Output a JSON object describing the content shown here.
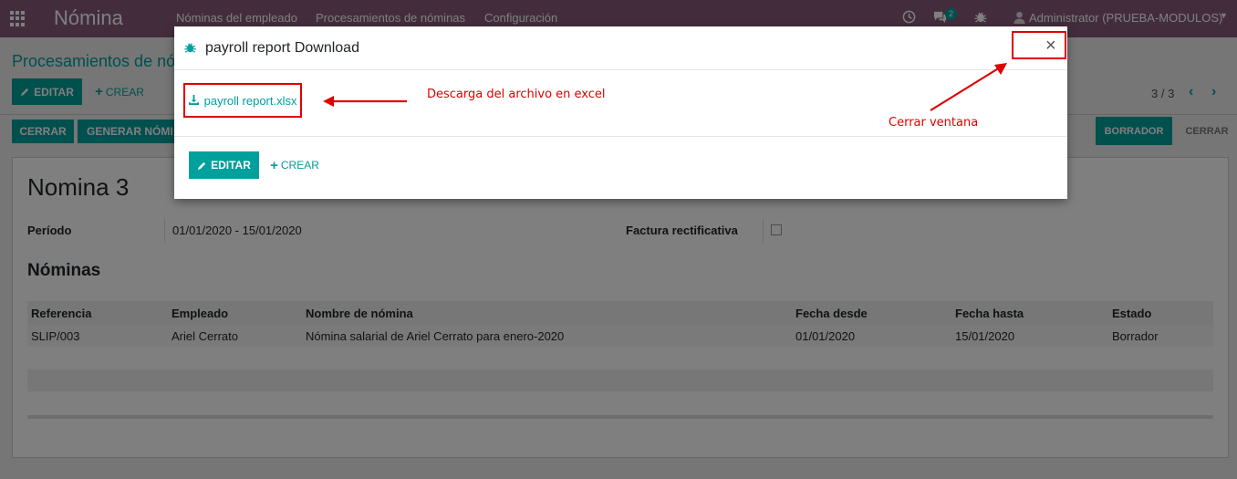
{
  "navbar": {
    "app_title": "Nómina",
    "menu": [
      "Nóminas del empleado",
      "Procesamientos de nóminas",
      "Configuración"
    ],
    "chat_badge": "2",
    "user": "Administrator (PRUEBA-MODULOS)"
  },
  "control": {
    "breadcrumb": "Procesamientos de nó",
    "edit": "EDITAR",
    "create": "CREAR",
    "pager": "3 / 3"
  },
  "statusbar": {
    "close_btn": "CERRAR",
    "generate_btn": "GENERAR NÓMI",
    "stages": [
      "BORRADOR",
      "CERRAR"
    ]
  },
  "form": {
    "title": "Nomina 3",
    "period_label": "Período",
    "period_value": "01/01/2020 - 15/01/2020",
    "refund_label": "Factura rectificativa",
    "section": "Nóminas",
    "columns": [
      "Referencia",
      "Empleado",
      "Nombre de nómina",
      "Fecha desde",
      "Fecha hasta",
      "Estado"
    ],
    "rows": [
      [
        "SLIP/003",
        "Ariel Cerrato",
        "Nómina salarial de Ariel Cerrato para enero-2020",
        "01/01/2020",
        "15/01/2020",
        "Borrador"
      ]
    ]
  },
  "modal": {
    "title": "payroll report Download",
    "file_link": "payroll report.xlsx",
    "edit": "EDITAR",
    "create": "CREAR",
    "close_symbol": "×"
  },
  "annotations": {
    "download": "Descarga del archivo en excel",
    "close": "Cerrar ventana",
    "color": "#e00000"
  },
  "colors": {
    "navbar": "#875a7b",
    "primary": "#00a09d"
  }
}
